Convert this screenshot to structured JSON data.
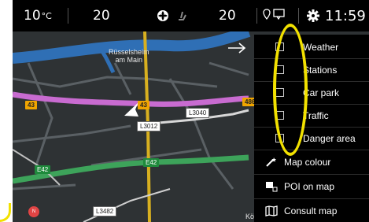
{
  "status_bar": {
    "outside_temp": "10",
    "outside_temp_unit": "°C",
    "temp_left": "20",
    "temp_right": "20",
    "time": "11:59"
  },
  "map": {
    "city_label_line1": "Rüsselsheim",
    "city_label_line2": "am Main",
    "roads": {
      "r1": "43",
      "r2": "43",
      "r3": "486",
      "l3012": "L3012",
      "l3040": "L3040",
      "e42_left": "E42",
      "e42_center": "E42",
      "l3482": "L3482",
      "bottom_text": "Kö"
    }
  },
  "menu": {
    "items": [
      {
        "label": "Weather",
        "checked": false
      },
      {
        "label": "Stations",
        "checked": false
      },
      {
        "label": "Car park",
        "checked": false
      },
      {
        "label": "Traffic",
        "checked": false
      },
      {
        "label": "Danger area",
        "checked": false
      }
    ],
    "map_colour": "Map colour",
    "poi_on_map": "POI on map",
    "consult_map": "Consult map"
  },
  "colors": {
    "highlight": "#f2e100",
    "route": "#c86bd0",
    "main_road": "#d8b020",
    "water": "#2f6fb5",
    "map_bg": "#2e3234"
  }
}
